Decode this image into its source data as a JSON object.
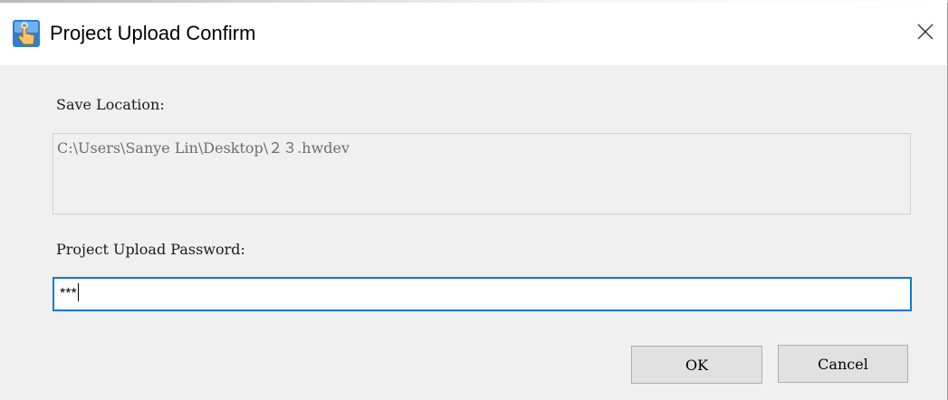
{
  "window": {
    "title": "Project Upload Confirm",
    "icon": "hand-pointer-app-icon",
    "close_icon": "close-icon"
  },
  "form": {
    "save_location_label": "Save Location:",
    "save_location_value": "C:\\Users\\Sanye Lin\\Desktop\\２３.hwdev",
    "password_label": "Project Upload Password:",
    "password_value": "***"
  },
  "buttons": {
    "ok_label": "OK",
    "cancel_label": "Cancel"
  },
  "colors": {
    "focus_border": "#0a78d7",
    "dialog_background": "#f0f0f0",
    "button_background": "#e1e1e1"
  }
}
